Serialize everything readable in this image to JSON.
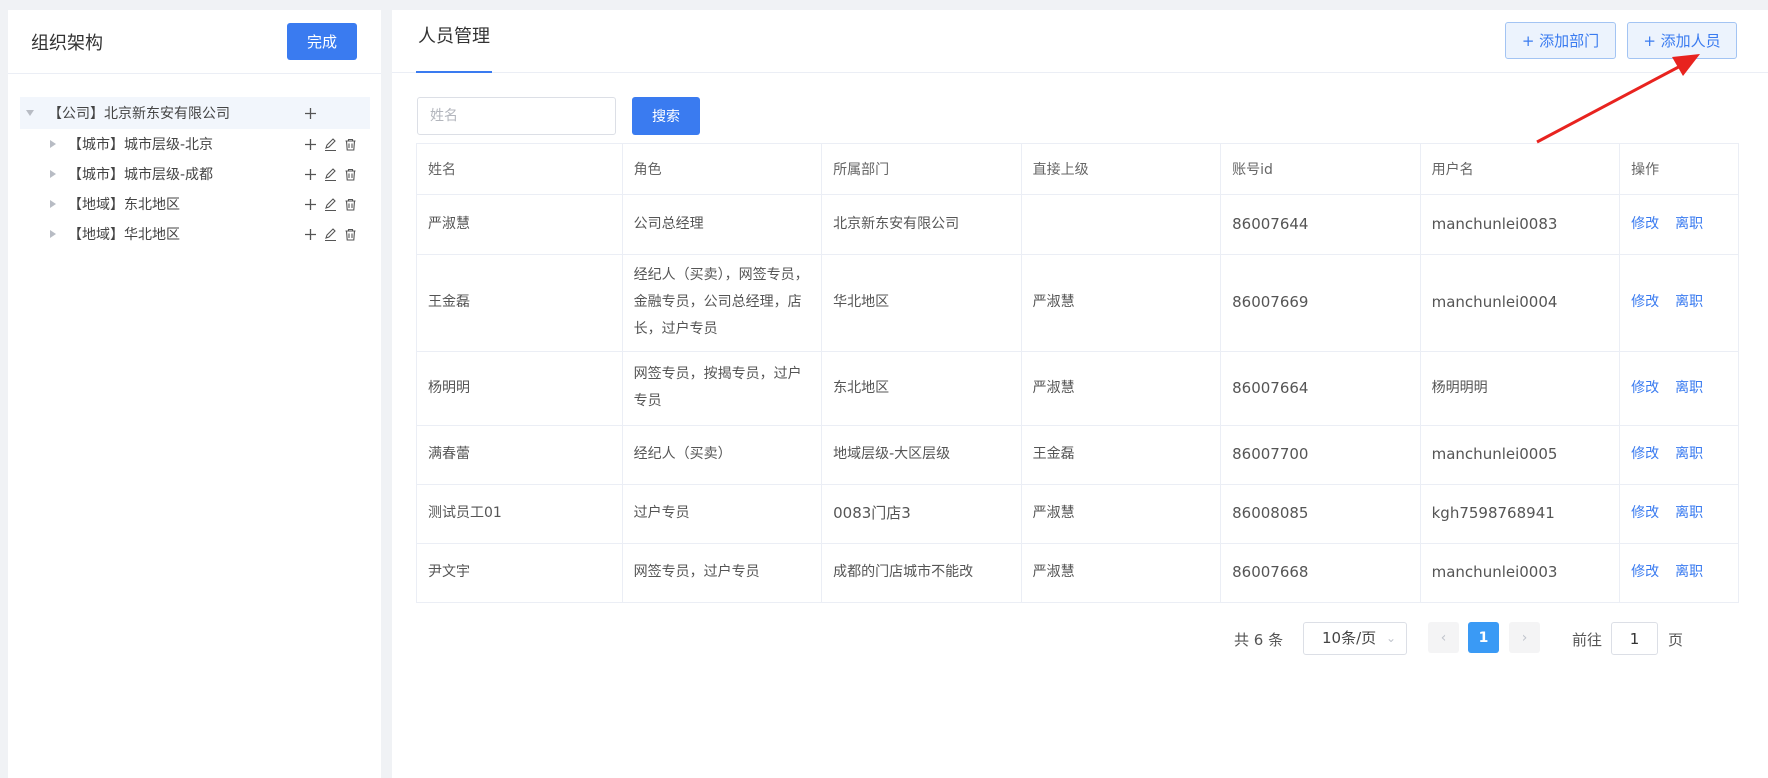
{
  "left": {
    "title": "组织架构",
    "done_label": "完成",
    "tree": {
      "root": {
        "label": "【公司】北京新东安有限公司"
      },
      "children": [
        {
          "label": "【城市】城市层级-北京"
        },
        {
          "label": "【城市】城市层级-成都"
        },
        {
          "label": "【地域】东北地区"
        },
        {
          "label": "【地域】华北地区"
        }
      ]
    }
  },
  "main": {
    "tab_title": "人员管理",
    "add_dept_label": "+ 添加部门",
    "add_person_label": "+ 添加人员",
    "search": {
      "placeholder": "姓名",
      "button_label": "搜索"
    },
    "table": {
      "columns": [
        "姓名",
        "角色",
        "所属部门",
        "直接上级",
        "账号id",
        "用户名",
        "操作"
      ],
      "rows": [
        {
          "name": "严淑慧",
          "role": "公司总经理",
          "dept": "北京新东安有限公司",
          "manager": "",
          "account_id": "86007644",
          "username": "manchunlei0083",
          "edit": "修改",
          "leave": "离职"
        },
        {
          "name": "王金磊",
          "role": "经纪人（买卖），网签专员，金融专员，公司总经理，店长，过户专员",
          "dept": "华北地区",
          "manager": "严淑慧",
          "account_id": "86007669",
          "username": "manchunlei0004",
          "edit": "修改",
          "leave": "离职"
        },
        {
          "name": "杨明明",
          "role": "网签专员，按揭专员，过户专员",
          "dept": "东北地区",
          "manager": "严淑慧",
          "account_id": "86007664",
          "username": "杨明明明",
          "edit": "修改",
          "leave": "离职"
        },
        {
          "name": "满春蕾",
          "role": "经纪人（买卖）",
          "dept": "地域层级-大区层级",
          "manager": "王金磊",
          "account_id": "86007700",
          "username": "manchunlei0005",
          "edit": "修改",
          "leave": "离职"
        },
        {
          "name": "测试员工01",
          "role": "过户专员",
          "dept": "0083门店3",
          "manager": "严淑慧",
          "account_id": "86008085",
          "username": "kgh7598768941",
          "edit": "修改",
          "leave": "离职"
        },
        {
          "name": "尹文宇",
          "role": "网签专员，过户专员",
          "dept": "成都的门店城市不能改",
          "manager": "严淑慧",
          "account_id": "86007668",
          "username": "manchunlei0003",
          "edit": "修改",
          "leave": "离职"
        }
      ]
    },
    "pagination": {
      "total_label": "共 6 条",
      "page_size": "10条/页",
      "current_page": "1",
      "goto_prefix": "前往",
      "goto_value": "1",
      "goto_suffix": "页"
    }
  },
  "colors": {
    "primary": "#3a7bf0",
    "arrow": "#e8231f"
  },
  "icons": [
    "plus-icon",
    "edit-icon",
    "delete-icon",
    "caret-down-icon",
    "caret-right-icon",
    "chevron-left-icon",
    "chevron-right-icon",
    "chevron-down-icon"
  ]
}
